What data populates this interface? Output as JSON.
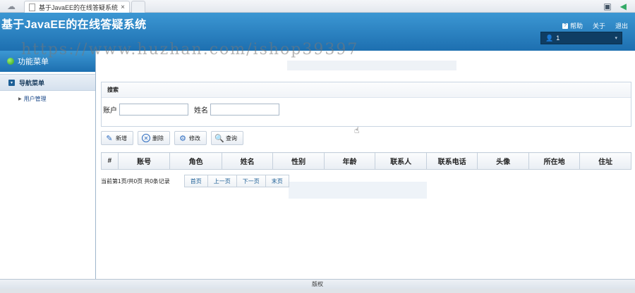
{
  "browser": {
    "tab_title": "基于JavaEE的在线答疑系统",
    "tab_close": "×"
  },
  "header": {
    "app_title": "基于JavaEE的在线答疑系统",
    "help_label": "帮助",
    "about_label": "关于",
    "logout_label": "退出",
    "user_name": "1"
  },
  "sidebar": {
    "title": "功能菜单",
    "group_label": "导航菜单",
    "items": [
      {
        "label": "用户管理"
      }
    ]
  },
  "search": {
    "title": "搜索",
    "account_label": "账户",
    "account_value": "",
    "name_label": "姓名",
    "name_value": ""
  },
  "toolbar": {
    "add_label": "新增",
    "delete_label": "删除",
    "edit_label": "修改",
    "query_label": "查询"
  },
  "table": {
    "columns": [
      "#",
      "账号",
      "角色",
      "姓名",
      "性别",
      "年龄",
      "联系人",
      "联系电话",
      "头像",
      "所在地",
      "住址"
    ]
  },
  "pager": {
    "info": "当前第1页/共0页  共0条记录",
    "first": "首页",
    "prev": "上一页",
    "next": "下一页",
    "last": "末页"
  },
  "footer": {
    "copyright": "版权"
  },
  "watermark": "https://www.huzhan.com/ishop39397"
}
